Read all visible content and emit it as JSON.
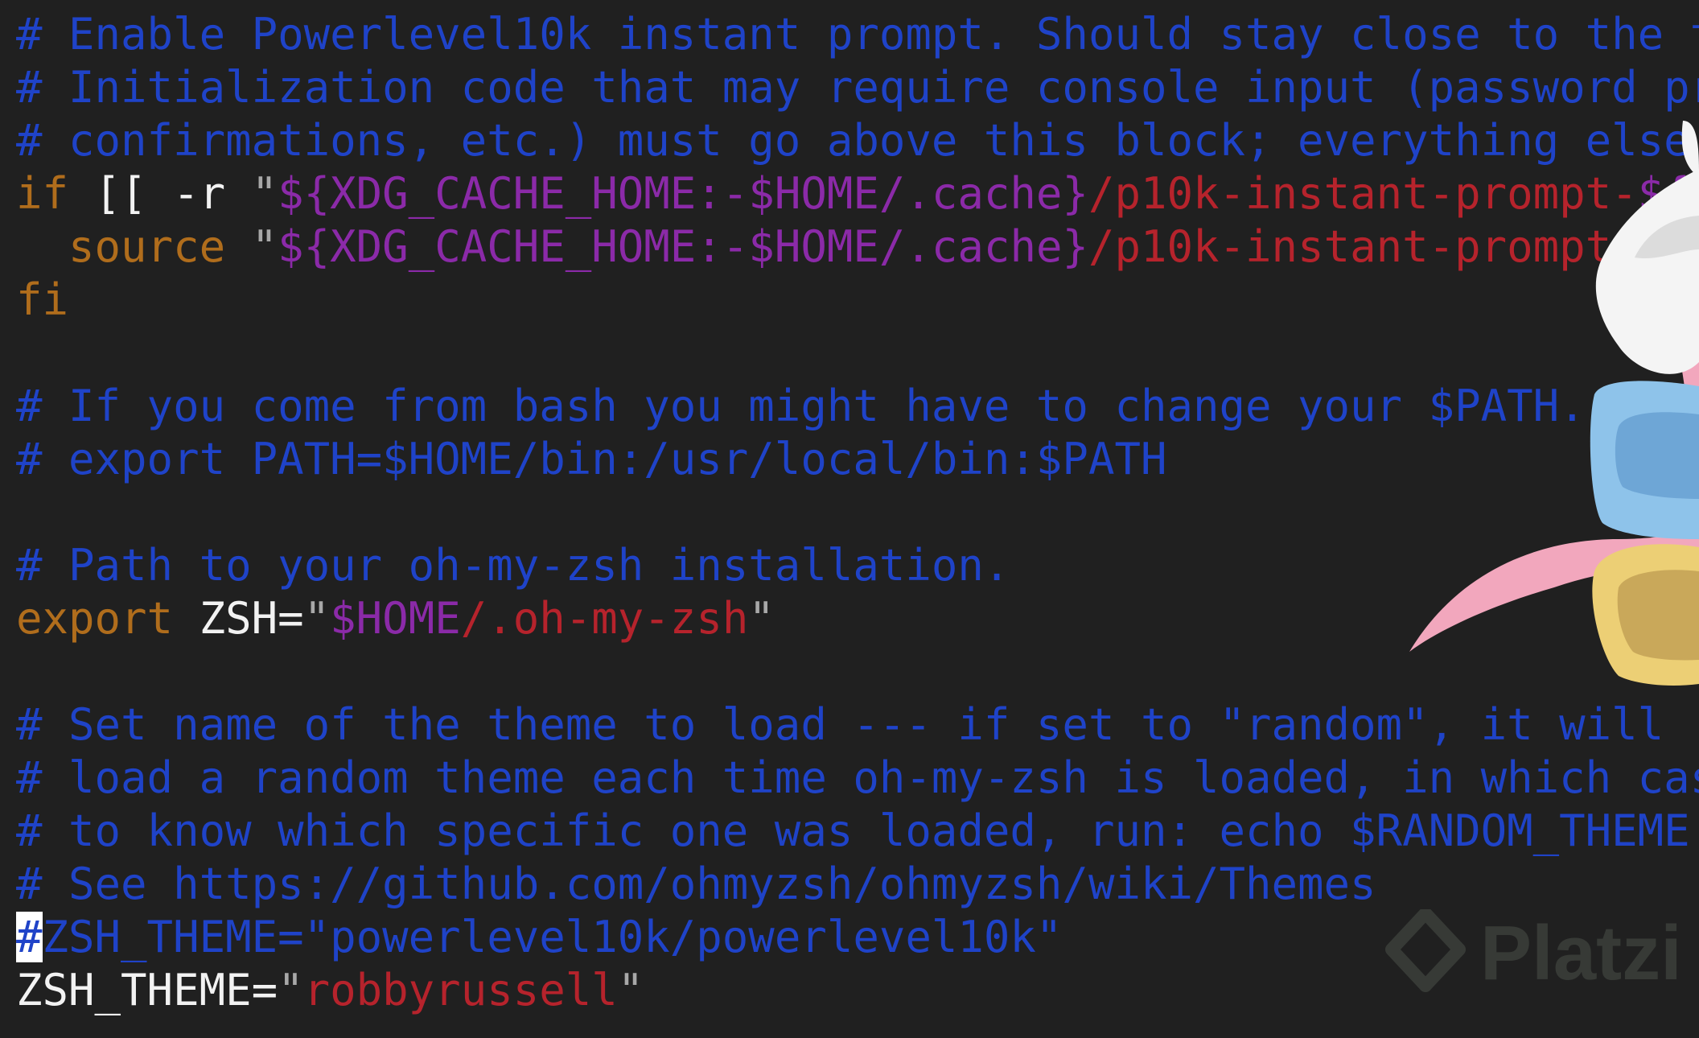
{
  "editor": {
    "lines": [
      [
        {
          "t": "# Enable Powerlevel10k instant prompt. Should stay close to the top",
          "c": "comment"
        }
      ],
      [
        {
          "t": "# Initialization code that may require console input (password promp",
          "c": "comment"
        }
      ],
      [
        {
          "t": "# confirmations, etc.) must go above this block; everything else may",
          "c": "comment"
        }
      ],
      [
        {
          "t": "if",
          "c": "keyword"
        },
        {
          "t": " [[ -r ",
          "c": "plain"
        },
        {
          "t": "\"",
          "c": "quote"
        },
        {
          "t": "${XDG_CACHE_HOME:-$HOME/.cache}",
          "c": "var"
        },
        {
          "t": "/p10k-instant-prompt-",
          "c": "str"
        },
        {
          "t": "${(%):",
          "c": "var"
        }
      ],
      [
        {
          "t": "  ",
          "c": "plain"
        },
        {
          "t": "source",
          "c": "keyword"
        },
        {
          "t": " ",
          "c": "plain"
        },
        {
          "t": "\"",
          "c": "quote"
        },
        {
          "t": "${XDG_CACHE_HOME:-$HOME/.cache}",
          "c": "var"
        },
        {
          "t": "/p10k-instant-prompt-",
          "c": "str"
        },
        {
          "t": "${(%):",
          "c": "var"
        }
      ],
      [
        {
          "t": "fi",
          "c": "keyword"
        }
      ],
      [],
      [
        {
          "t": "# If you come from bash you might have to change your $PATH.",
          "c": "comment"
        }
      ],
      [
        {
          "t": "# export PATH=$HOME/bin:/usr/local/bin:$PATH",
          "c": "comment"
        }
      ],
      [],
      [
        {
          "t": "# Path to your oh-my-zsh installation.",
          "c": "comment"
        }
      ],
      [
        {
          "t": "export",
          "c": "keyword"
        },
        {
          "t": " ZSH=",
          "c": "plain"
        },
        {
          "t": "\"",
          "c": "quote"
        },
        {
          "t": "$HOME",
          "c": "var"
        },
        {
          "t": "/.oh-my-zsh",
          "c": "str"
        },
        {
          "t": "\"",
          "c": "quote"
        }
      ],
      [],
      [
        {
          "t": "# Set name of the theme to load --- if set to \"random\", it will",
          "c": "comment"
        }
      ],
      [
        {
          "t": "# load a random theme each time oh-my-zsh is loaded, in which case,",
          "c": "comment"
        }
      ],
      [
        {
          "t": "# to know which specific one was loaded, run: echo $RANDOM_THEME",
          "c": "comment"
        }
      ],
      [
        {
          "t": "# See https://github.com/ohmyzsh/ohmyzsh/wiki/Themes",
          "c": "comment"
        }
      ],
      [
        {
          "t": "#",
          "c": "cursor"
        },
        {
          "t": "ZSH_THEME=\"powerlevel10k/powerlevel10k\"",
          "c": "comment"
        }
      ],
      [
        {
          "t": "ZSH_THEME=",
          "c": "plain"
        },
        {
          "t": "\"",
          "c": "quote"
        },
        {
          "t": "robbyrussell",
          "c": "str"
        },
        {
          "t": "\"",
          "c": "quote"
        }
      ]
    ]
  },
  "watermark": {
    "text": "Platzi"
  },
  "colors": {
    "background": "#202020",
    "comment": "#1f43c8",
    "keyword": "#b06d1c",
    "plain": "#f2f2f2",
    "var": "#8b2aa8",
    "string": "#b6232c",
    "cursor": "#ffffff"
  }
}
